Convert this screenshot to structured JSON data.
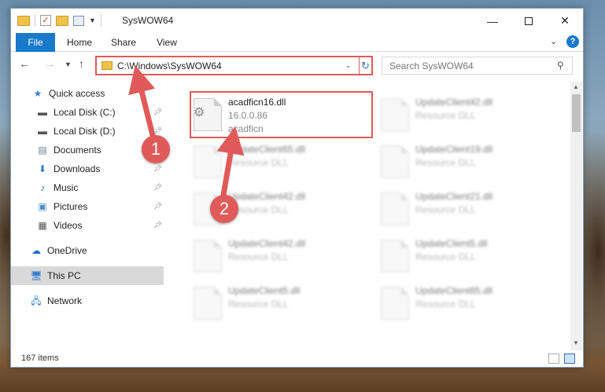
{
  "window": {
    "title": "SysWOW64",
    "minimize_label": "—",
    "close_label": "✕"
  },
  "ribbon": {
    "tabs": [
      "File",
      "Home",
      "Share",
      "View"
    ],
    "help_label": "?"
  },
  "navbar": {
    "address": "C:\\Windows\\SysWOW64",
    "search_placeholder": "Search SysWOW64"
  },
  "sidebar": {
    "items": [
      {
        "label": "Quick access",
        "icon": "star-icon"
      },
      {
        "label": "Local Disk (C:)",
        "icon": "drive-icon"
      },
      {
        "label": "Local Disk (D:)",
        "icon": "drive-icon"
      },
      {
        "label": "Documents",
        "icon": "documents-icon"
      },
      {
        "label": "Downloads",
        "icon": "download-icon"
      },
      {
        "label": "Music",
        "icon": "music-icon"
      },
      {
        "label": "Pictures",
        "icon": "pictures-icon"
      },
      {
        "label": "Videos",
        "icon": "videos-icon"
      },
      {
        "label": "OneDrive",
        "icon": "cloud-icon"
      },
      {
        "label": "This PC",
        "icon": "computer-icon"
      },
      {
        "label": "Network",
        "icon": "network-icon"
      }
    ]
  },
  "files": [
    {
      "name": "acadficn16.dll",
      "line1": "16.0.0.86",
      "line2": "acadficn",
      "highlighted": true
    },
    {
      "name": "UpdateClient42.dll",
      "line1": "Resource DLL",
      "line2": ""
    },
    {
      "name": "UpdateClient65.dll",
      "line1": "Resource DLL",
      "line2": ""
    },
    {
      "name": "UpdateClient19.dll",
      "line1": "Resource DLL",
      "line2": ""
    },
    {
      "name": "UpdateClient42.dll",
      "line1": "Resource DLL",
      "line2": ""
    },
    {
      "name": "UpdateClient21.dll",
      "line1": "Resource DLL",
      "line2": ""
    },
    {
      "name": "UpdateClient42.dll",
      "line1": "Resource DLL",
      "line2": ""
    },
    {
      "name": "UpdateClient5.dll",
      "line1": "Resource DLL",
      "line2": ""
    },
    {
      "name": "UpdateClient5.dll",
      "line1": "Resource DLL",
      "line2": ""
    },
    {
      "name": "UpdateClient65.dll",
      "line1": "Resource DLL",
      "line2": ""
    }
  ],
  "status": {
    "item_count": "167 items"
  },
  "annotations": {
    "step1": "1",
    "step2": "2",
    "color": "#e05a5a"
  }
}
